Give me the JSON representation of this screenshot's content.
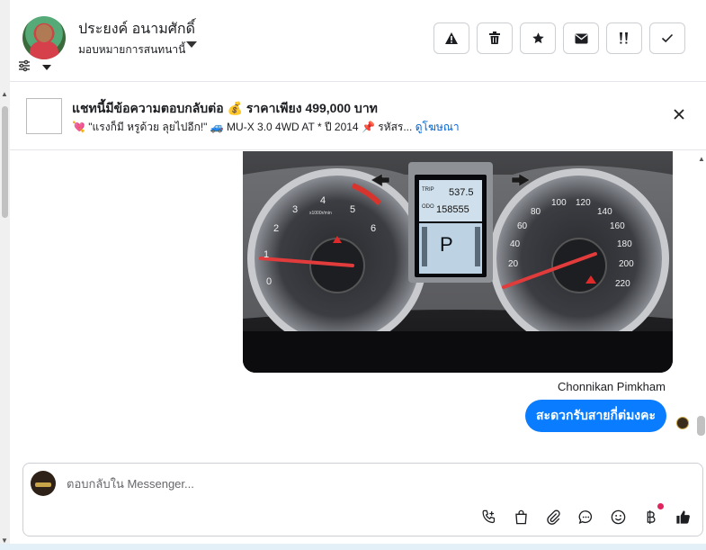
{
  "header": {
    "contact_name": "ประยงค์ อนามศักดิ์",
    "assign_label": "มอบหมายการสนทนานี้",
    "actions": [
      {
        "name": "report-button",
        "icon": "warning-icon"
      },
      {
        "name": "delete-button",
        "icon": "trash-icon"
      },
      {
        "name": "star-button",
        "icon": "star-icon"
      },
      {
        "name": "mark-unread-button",
        "icon": "envelope-icon"
      },
      {
        "name": "follow-up-button",
        "icon": "priority-icon"
      },
      {
        "name": "done-button",
        "icon": "check-icon"
      }
    ]
  },
  "banner": {
    "title": "แชทนี้มีข้อความตอบกลับต่อ 💰 ราคาเพียง 499,000 บาท",
    "subtitle": "💘 \"แรงก็มี หรูด้วย ลุยไปอีก!\" 🚙 MU-X 3.0 4WD AT * ปี 2014 📌 รหัสร...",
    "link": "ดูโฆษณา",
    "close_icon": "close-icon"
  },
  "chat": {
    "sender": "Chonnikan Pimkham",
    "message": "สะดวกรับสายกี่ต่มงคะ",
    "dashboard": {
      "trip": "537.5",
      "odo": "158555",
      "gear": "P",
      "tacho_ticks": [
        "0",
        "1",
        "2",
        "3",
        "4",
        "5",
        "6"
      ],
      "tacho_unit": "x1000r/min",
      "speedo_ticks": [
        "20",
        "40",
        "60",
        "80",
        "100",
        "120",
        "140",
        "160",
        "180",
        "200",
        "220"
      ],
      "trip_label": "TRIP",
      "odo_label": "ODO"
    }
  },
  "composer": {
    "placeholder": "ตอบกลับใน Messenger...",
    "tools": [
      "call-icon",
      "shop-bag-icon",
      "paperclip-icon",
      "chat-bubble-icon",
      "emoji-icon",
      "baht-icon",
      "thumbs-up-icon"
    ]
  },
  "colors": {
    "accent": "#0a7cff",
    "link": "#0064d1",
    "notification": "#e0245e"
  }
}
